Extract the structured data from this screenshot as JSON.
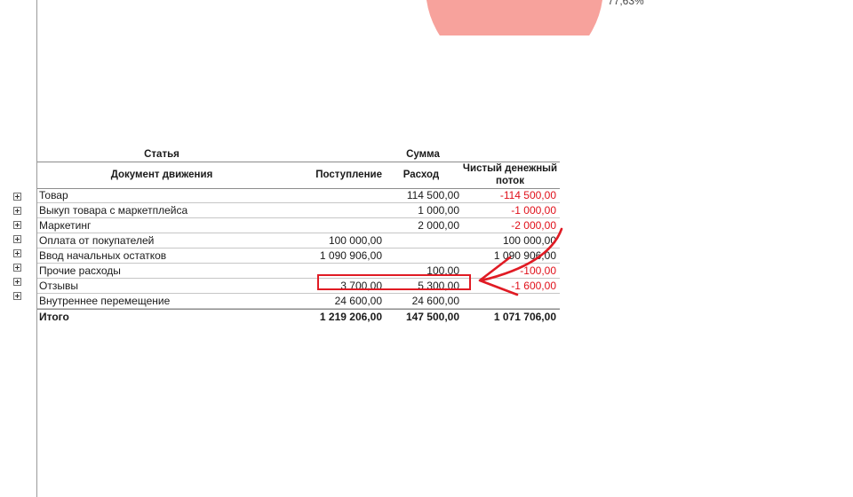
{
  "chart": {
    "pie_label": "77,63%",
    "slice_color": "#f7a29c"
  },
  "table": {
    "header": {
      "article": "Статья",
      "amount": "Сумма",
      "document": "Документ движения",
      "income": "Поступление",
      "expense": "Расход",
      "net_flow": "Чистый денежный поток"
    },
    "rows": [
      {
        "name": "Товар",
        "income": "",
        "expense": "114 500,00",
        "net": "-114 500,00"
      },
      {
        "name": "Выкуп товара с маркетплейса",
        "income": "",
        "expense": "1 000,00",
        "net": "-1 000,00"
      },
      {
        "name": "Маркетинг",
        "income": "",
        "expense": "2 000,00",
        "net": "-2 000,00"
      },
      {
        "name": "Оплата от покупателей",
        "income": "100 000,00",
        "expense": "",
        "net": "100 000,00"
      },
      {
        "name": "Ввод начальных остатков",
        "income": "1 090 906,00",
        "expense": "",
        "net": "1 090 906,00"
      },
      {
        "name": "Прочие расходы",
        "income": "",
        "expense": "100,00",
        "net": "-100,00"
      },
      {
        "name": "Отзывы",
        "income": "3 700,00",
        "expense": "5 300,00",
        "net": "-1 600,00"
      },
      {
        "name": "Внутреннее перемещение",
        "income": "24 600,00",
        "expense": "24 600,00",
        "net": ""
      }
    ],
    "total": {
      "name": "Итого",
      "income": "1 219 206,00",
      "expense": "147 500,00",
      "net": "1 071 706,00"
    }
  },
  "annotation": {
    "color": "#e01b24"
  }
}
